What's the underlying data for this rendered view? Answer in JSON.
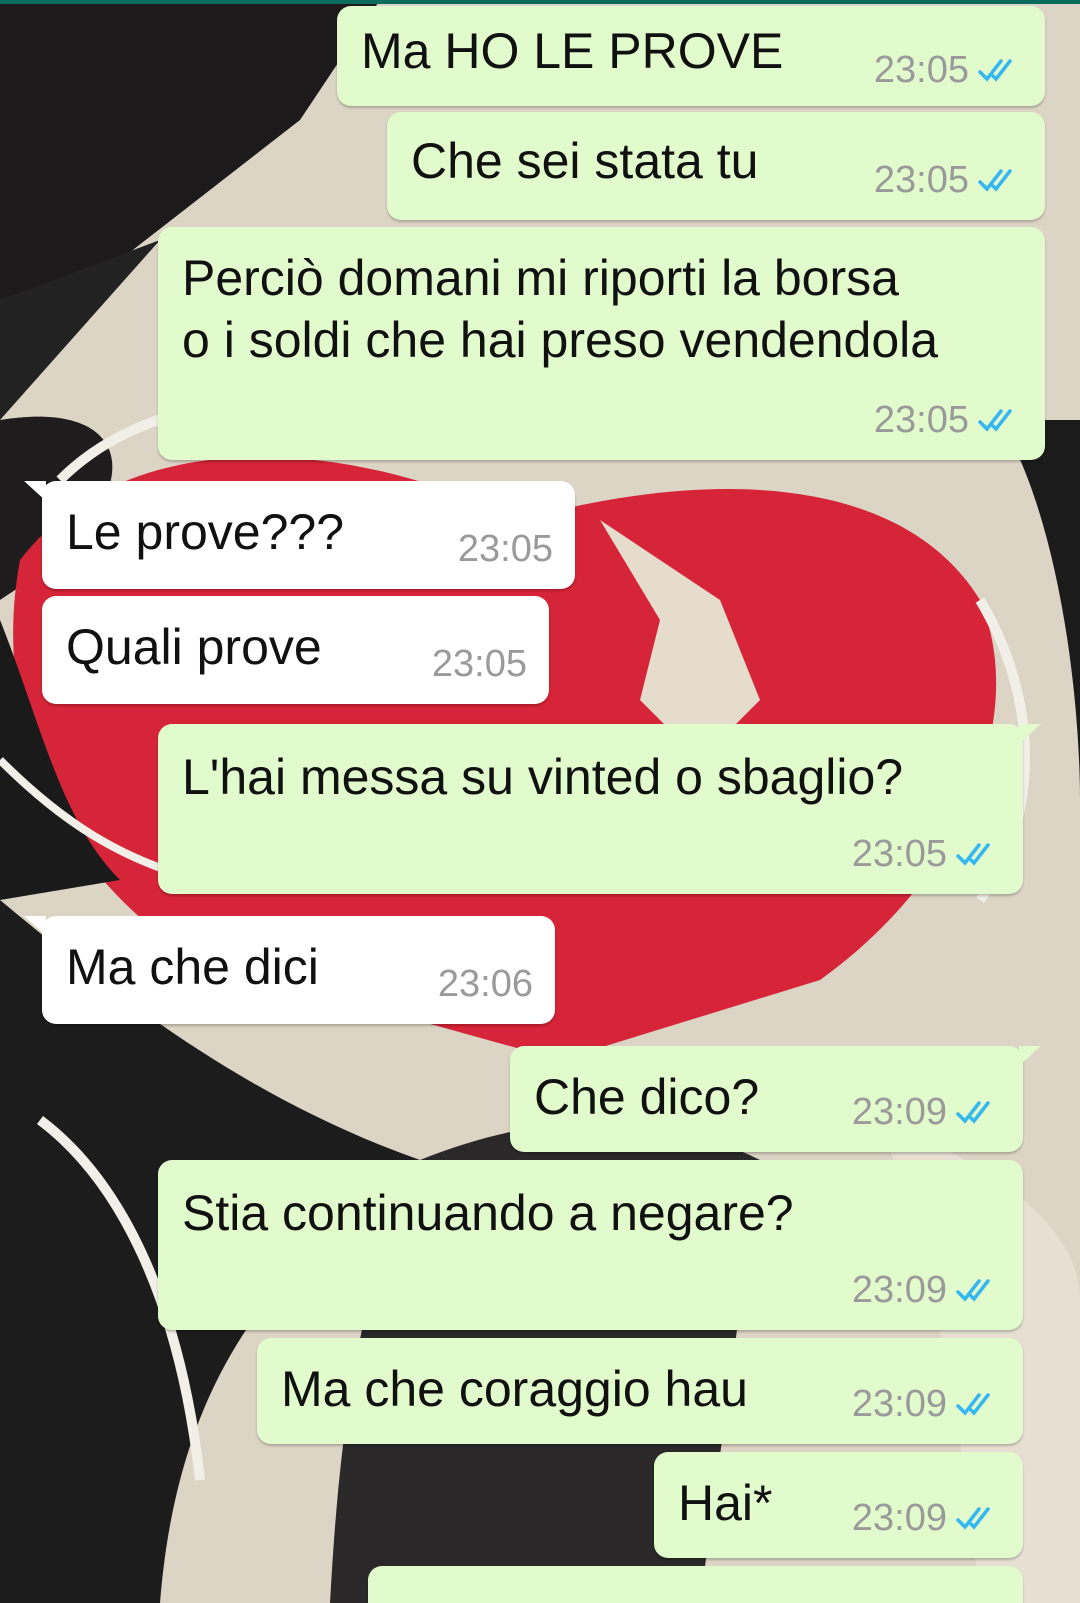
{
  "colors": {
    "outgoing_bubble": "#e1fbcd",
    "incoming_bubble": "#ffffff",
    "time_text": "#9a9a9a",
    "read_ticks": "#34b7f1",
    "header_accent": "#0b6b5c"
  },
  "icons": {
    "read_receipt": "double-check-icon"
  },
  "messages": [
    {
      "direction": "outgoing",
      "text": "Ma HO LE PROVE",
      "time": "23:05",
      "status": "read"
    },
    {
      "direction": "outgoing",
      "text": "Che sei stata tu",
      "time": "23:05",
      "status": "read"
    },
    {
      "direction": "outgoing",
      "text": "Perciò domani mi riporti la borsa\no i soldi che hai preso vendendola",
      "time": "23:05",
      "status": "read"
    },
    {
      "direction": "incoming",
      "text": "Le prove???",
      "time": "23:05"
    },
    {
      "direction": "incoming",
      "text": "Quali prove",
      "time": "23:05"
    },
    {
      "direction": "outgoing",
      "text": "L'hai messa su vinted o sbaglio?",
      "time": "23:05",
      "status": "read"
    },
    {
      "direction": "incoming",
      "text": "Ma che dici",
      "time": "23:06"
    },
    {
      "direction": "outgoing",
      "text": "Che dico?",
      "time": "23:09",
      "status": "read"
    },
    {
      "direction": "outgoing",
      "text": "Stia continuando a negare?",
      "time": "23:09",
      "status": "read"
    },
    {
      "direction": "outgoing",
      "text": "Ma che coraggio hau",
      "time": "23:09",
      "status": "read"
    },
    {
      "direction": "outgoing",
      "text": "Hai*",
      "time": "23:09",
      "status": "read"
    }
  ]
}
